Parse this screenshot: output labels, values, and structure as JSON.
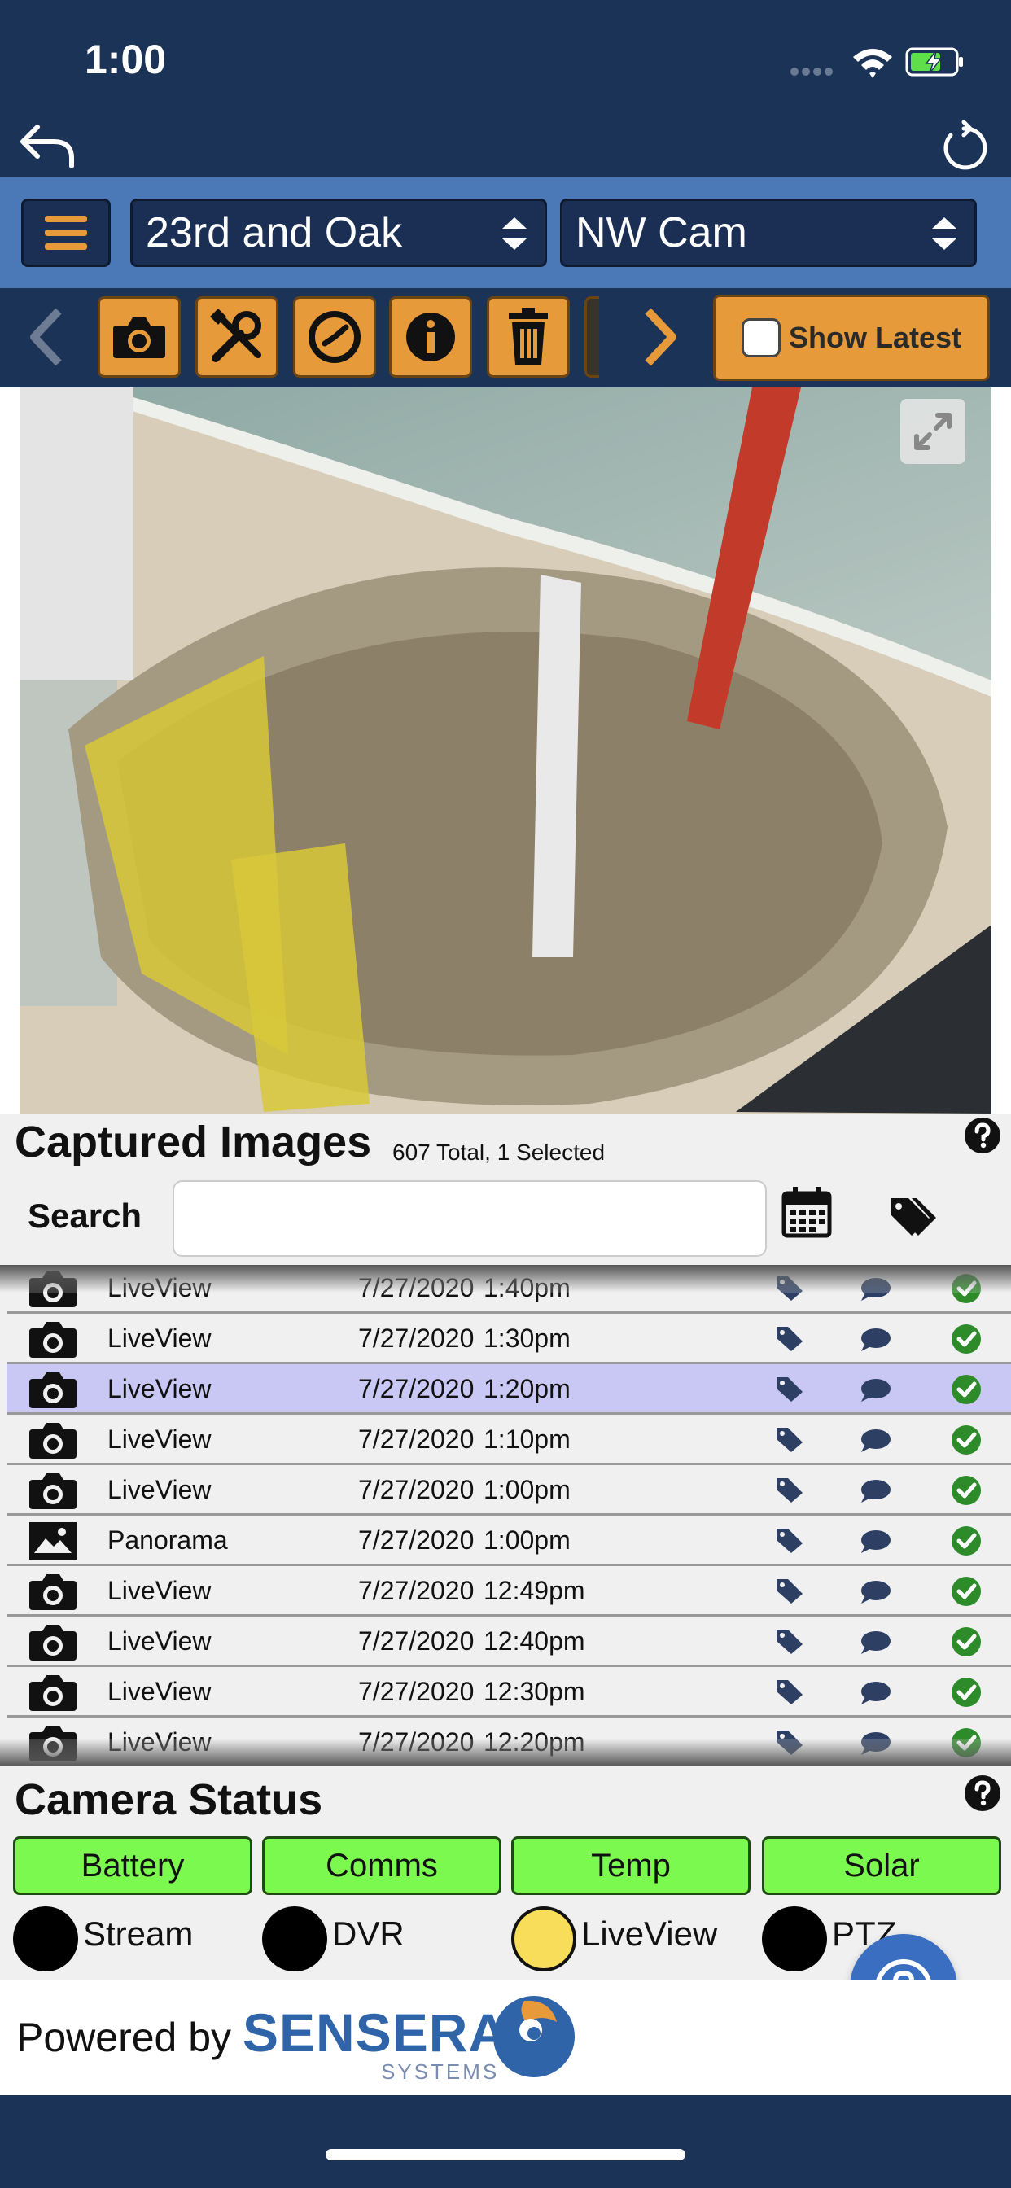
{
  "status_bar": {
    "time": "1:00"
  },
  "selectors": {
    "site": "23rd and Oak",
    "camera": "NW Cam"
  },
  "toolbar": {
    "show_latest_label": "Show Latest",
    "tools": [
      "camera-icon",
      "wrench-screwdriver-icon",
      "clock-icon",
      "info-icon",
      "trash-icon"
    ]
  },
  "captured": {
    "title": "Captured Images",
    "count": "607 Total, 1 Selected",
    "search_label": "Search",
    "search_value": "",
    "rows": [
      {
        "type": "LiveView",
        "date": "7/27/2020",
        "time": "1:40pm",
        "icon": "camera-icon"
      },
      {
        "type": "LiveView",
        "date": "7/27/2020",
        "time": "1:30pm",
        "icon": "camera-icon"
      },
      {
        "type": "LiveView",
        "date": "7/27/2020",
        "time": "1:20pm",
        "icon": "camera-icon",
        "selected": true
      },
      {
        "type": "LiveView",
        "date": "7/27/2020",
        "time": "1:10pm",
        "icon": "camera-icon"
      },
      {
        "type": "LiveView",
        "date": "7/27/2020",
        "time": "1:00pm",
        "icon": "camera-icon"
      },
      {
        "type": "Panorama",
        "date": "7/27/2020",
        "time": "1:00pm",
        "icon": "panorama-icon"
      },
      {
        "type": "LiveView",
        "date": "7/27/2020",
        "time": "12:49pm",
        "icon": "camera-icon"
      },
      {
        "type": "LiveView",
        "date": "7/27/2020",
        "time": "12:40pm",
        "icon": "camera-icon"
      },
      {
        "type": "LiveView",
        "date": "7/27/2020",
        "time": "12:30pm",
        "icon": "camera-icon"
      },
      {
        "type": "LiveView",
        "date": "7/27/2020",
        "time": "12:20pm",
        "icon": "camera-icon"
      }
    ]
  },
  "camera_status": {
    "title": "Camera Status",
    "pills": {
      "battery": "Battery",
      "comms": "Comms",
      "temp": "Temp",
      "solar": "Solar"
    },
    "indicators": {
      "stream": "Stream",
      "dvr": "DVR",
      "liveview": "LiveView",
      "ptz": "PTZ"
    },
    "colors": {
      "ok": "#7cf94f",
      "inactive": "#000000",
      "warning": "#f8dd5a"
    }
  },
  "footer": {
    "powered_by": "Powered by",
    "brand": "SENSERA",
    "brand_sub": "SYSTEMS"
  },
  "colors": {
    "navy": "#1c3358",
    "accent_blue": "#4b79b8",
    "tool_orange": "#e69a3a",
    "selected_row": "#c9c8f4"
  }
}
